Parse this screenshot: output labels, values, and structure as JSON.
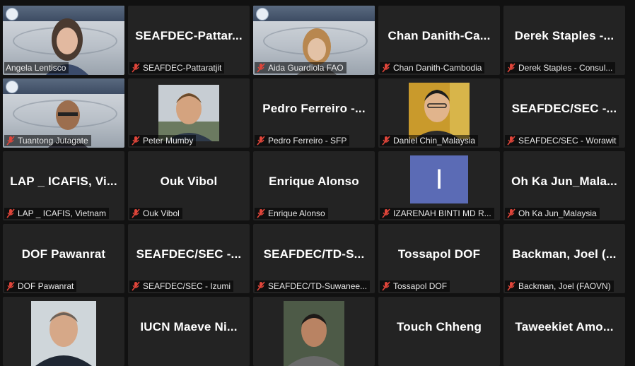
{
  "colors": {
    "background": "#111111",
    "tile": "#232323",
    "active_speaker_border": "#e4d93b",
    "muted_mic": "#e0453a",
    "avatar_tile": "#5b6bb5"
  },
  "participants": [
    {
      "display": "",
      "label": "Angela Lentisco",
      "video": "slide-face",
      "active": true
    },
    {
      "display": "SEAFDEC-Pattar...",
      "label": "SEAFDEC-Pattaratjit"
    },
    {
      "display": "",
      "label": "Aida Guardiola FAO",
      "video": "slide-face"
    },
    {
      "display": "Chan Danith-Ca...",
      "label": "Chan Danith-Cambodia"
    },
    {
      "display": "Derek Staples -...",
      "label": "Derek Staples - Consul..."
    },
    {
      "display": "",
      "label": "Tuantong Jutagate",
      "video": "slide-face"
    },
    {
      "display": "",
      "label": "Peter Mumby",
      "video": "photo"
    },
    {
      "display": "Pedro Ferreiro -...",
      "label": "Pedro Ferreiro - SFP"
    },
    {
      "display": "",
      "label": "Daniel Chin_Malaysia",
      "video": "photo"
    },
    {
      "display": "SEAFDEC/SEC -...",
      "label": "SEAFDEC/SEC - Worawit"
    },
    {
      "display": "LAP _ ICAFIS, Vi...",
      "label": "LAP _ ICAFIS, Vietnam"
    },
    {
      "display": "Ouk Vibol",
      "label": "Ouk Vibol"
    },
    {
      "display": "Enrique Alonso",
      "label": "Enrique Alonso"
    },
    {
      "display": "",
      "label": "IZARENAH BINTI MD R...",
      "video": "avatar",
      "avatar_letter": "I"
    },
    {
      "display": "Oh Ka Jun_Mala...",
      "label": "Oh Ka Jun_Malaysia"
    },
    {
      "display": "DOF Pawanrat",
      "label": "DOF Pawanrat"
    },
    {
      "display": "SEAFDEC/SEC -...",
      "label": "SEAFDEC/SEC - Izumi"
    },
    {
      "display": "SEAFDEC/TD-S...",
      "label": "SEAFDEC/TD-Suwanee..."
    },
    {
      "display": "Tossapol DOF",
      "label": "Tossapol DOF"
    },
    {
      "display": "Backman, Joel (...",
      "label": "Backman, Joel (FAOVN)"
    },
    {
      "display": "",
      "label": "",
      "video": "photo"
    },
    {
      "display": "IUCN Maeve Ni...",
      "label": ""
    },
    {
      "display": "",
      "label": "",
      "video": "photo"
    },
    {
      "display": "Touch Chheng",
      "label": ""
    },
    {
      "display": "Taweekiet Amo...",
      "label": ""
    }
  ]
}
